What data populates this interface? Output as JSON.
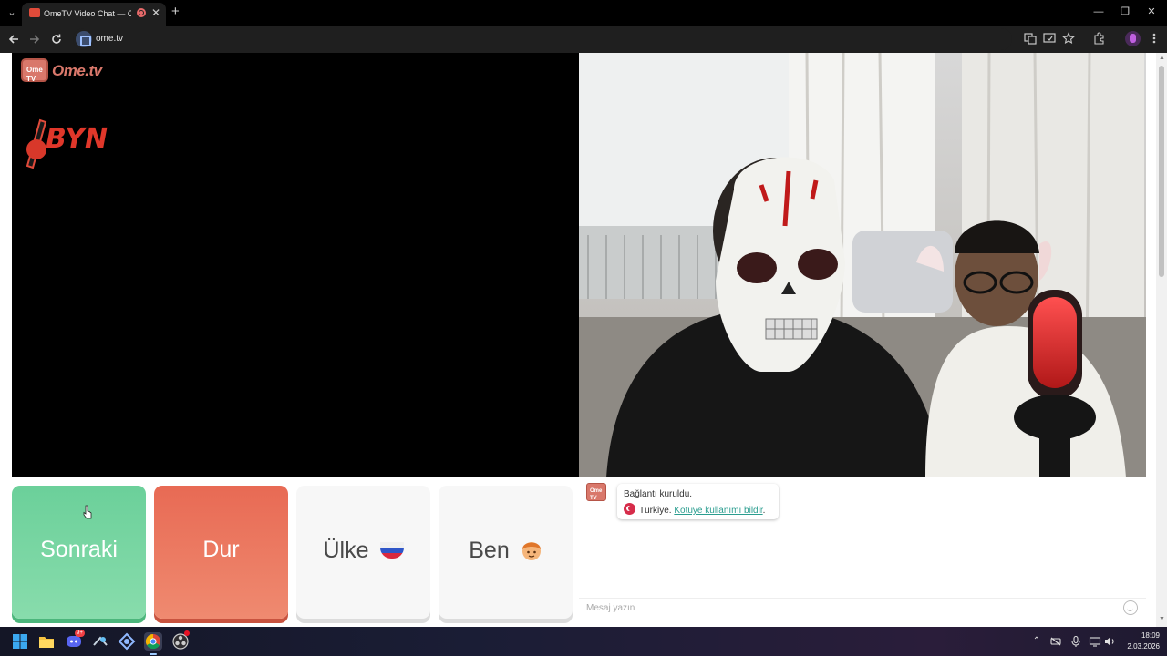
{
  "browser": {
    "tab_title": "OmeTV Video Chat — Ome",
    "tab_close": "✕",
    "new_tab": "+",
    "tab_list": "⌄",
    "url": "ome.tv",
    "window_controls": {
      "minimize": "—",
      "maximize": "❐",
      "close": "✕"
    },
    "icons": [
      "translate-icon",
      "cast-icon",
      "bookmark-star-icon",
      "extensions-icon",
      "profile-icon",
      "menu-icon"
    ]
  },
  "site": {
    "logo_tv_label": "Ome TV",
    "logo_text": "Ome.tv",
    "channel_logo_text": "BYN"
  },
  "buttons": {
    "next_label": "Sonraki",
    "stop_label": "Dur",
    "country_label": "Ülke",
    "me_label": "Ben"
  },
  "chat": {
    "avatar_label": "Ome TV",
    "line1": "Bağlantı kuruldu.",
    "country": "Türkiye.",
    "report_link": "Kötüye kullanımı bildir",
    "report_suffix": ".",
    "input_placeholder": "Mesaj yazın"
  },
  "taskbar": {
    "time": "18:09",
    "date": "2.03.2026",
    "discord_badge": "9+"
  },
  "colors": {
    "next": "#6bd09a",
    "stop": "#e86a54",
    "brand": "#d9786b",
    "link": "#2a9d8f"
  }
}
